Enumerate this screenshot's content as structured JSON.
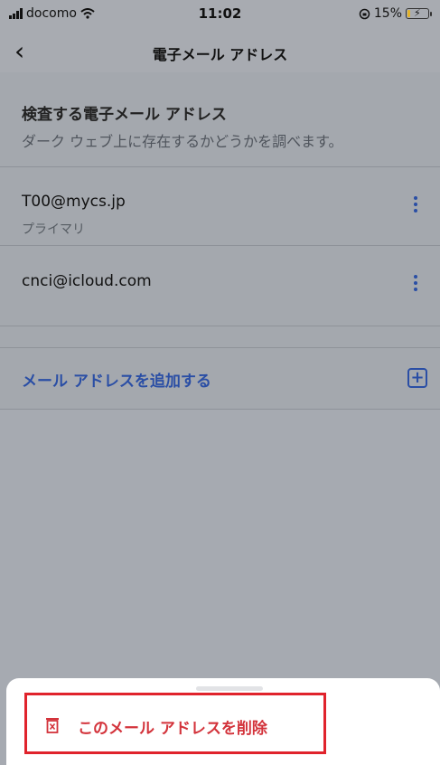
{
  "status_bar": {
    "carrier": "docomo",
    "time": "11:02",
    "battery_percent": "15%",
    "battery_level": 0.15
  },
  "nav": {
    "title": "電子メール アドレス"
  },
  "section": {
    "title": "検査する電子メール アドレス",
    "subtitle": "ダーク ウェブ上に存在するかどうかを調べます。"
  },
  "emails": [
    {
      "address": "T00@mycs.jp",
      "label": "プライマリ"
    },
    {
      "address": "cnci@icloud.com"
    }
  ],
  "add_email": {
    "label": "メール アドレスを追加する",
    "icon": "plus-square-icon"
  },
  "sheet": {
    "delete_label": "このメール アドレスを削除",
    "delete_icon": "trash-icon"
  },
  "colors": {
    "accent": "#2a4ea5",
    "danger": "#d3333b",
    "highlight_border": "#e0232c"
  }
}
